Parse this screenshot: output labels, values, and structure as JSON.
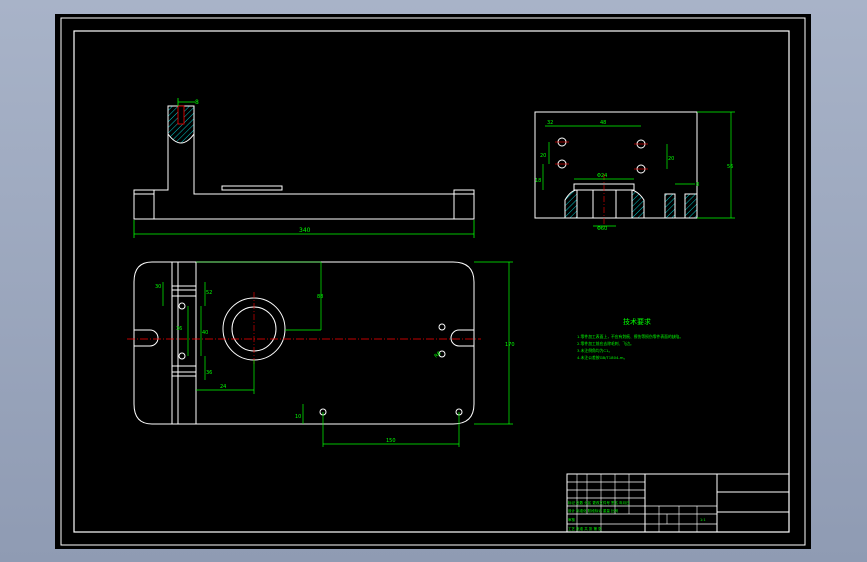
{
  "app": {
    "type": "CAD drawing viewer"
  },
  "colors": {
    "background": "#000000",
    "outline": "#ffffff",
    "dimension": "#00ff00",
    "centerline": "#ff0000",
    "hatch": "#00c8c8",
    "frame_outer": "#ffffff",
    "text_green": "#00ff00"
  },
  "dimensions": {
    "front_slot_width": "8",
    "front_overall_width": "340",
    "side_top_left": "32",
    "side_top_mid": "48",
    "side_height": "56",
    "side_left_vertical_1": "20",
    "side_left_vertical_2": "18",
    "side_right_vertical": "20",
    "side_bore": "Φ24",
    "side_counterbore": "Φ60",
    "side_slot": "8",
    "plan_left_top": "30",
    "plan_left_height": "52",
    "plan_left_inner": "36",
    "plan_left_mid": "40",
    "plan_left_low": "36",
    "plan_left_bottom": "24",
    "plan_bore_depth": "88",
    "plan_overall_height": "170",
    "plan_hole_label": "R8",
    "plan_bottom_small": "10",
    "plan_bottom_width": "150"
  },
  "notes": {
    "title": "技术要求",
    "lines": [
      "1.零件加工表面上，不应有划痕、擦伤等损伤零件表面的缺陷。",
      "2.零件加工前应去除毛刺、飞边。",
      "3.未注倒角均为C1。",
      "4.未注公差按GB/T1804-m。"
    ]
  },
  "title_block": {
    "rows": [
      "标记 处数 分区 更改文件号 签名 年月日",
      "设计 标准化 阶段标记 重量 比例",
      "审核",
      "工艺 批准 共 张 第 张"
    ],
    "labels": {
      "stage": "阶段标记",
      "weight": "重量",
      "scale": "比例",
      "scale_value": "1:1",
      "design": "设计",
      "standardization": "标准化",
      "approve": "批准",
      "process": "工艺",
      "sheet_total": "共",
      "sheet_num": "张"
    }
  }
}
